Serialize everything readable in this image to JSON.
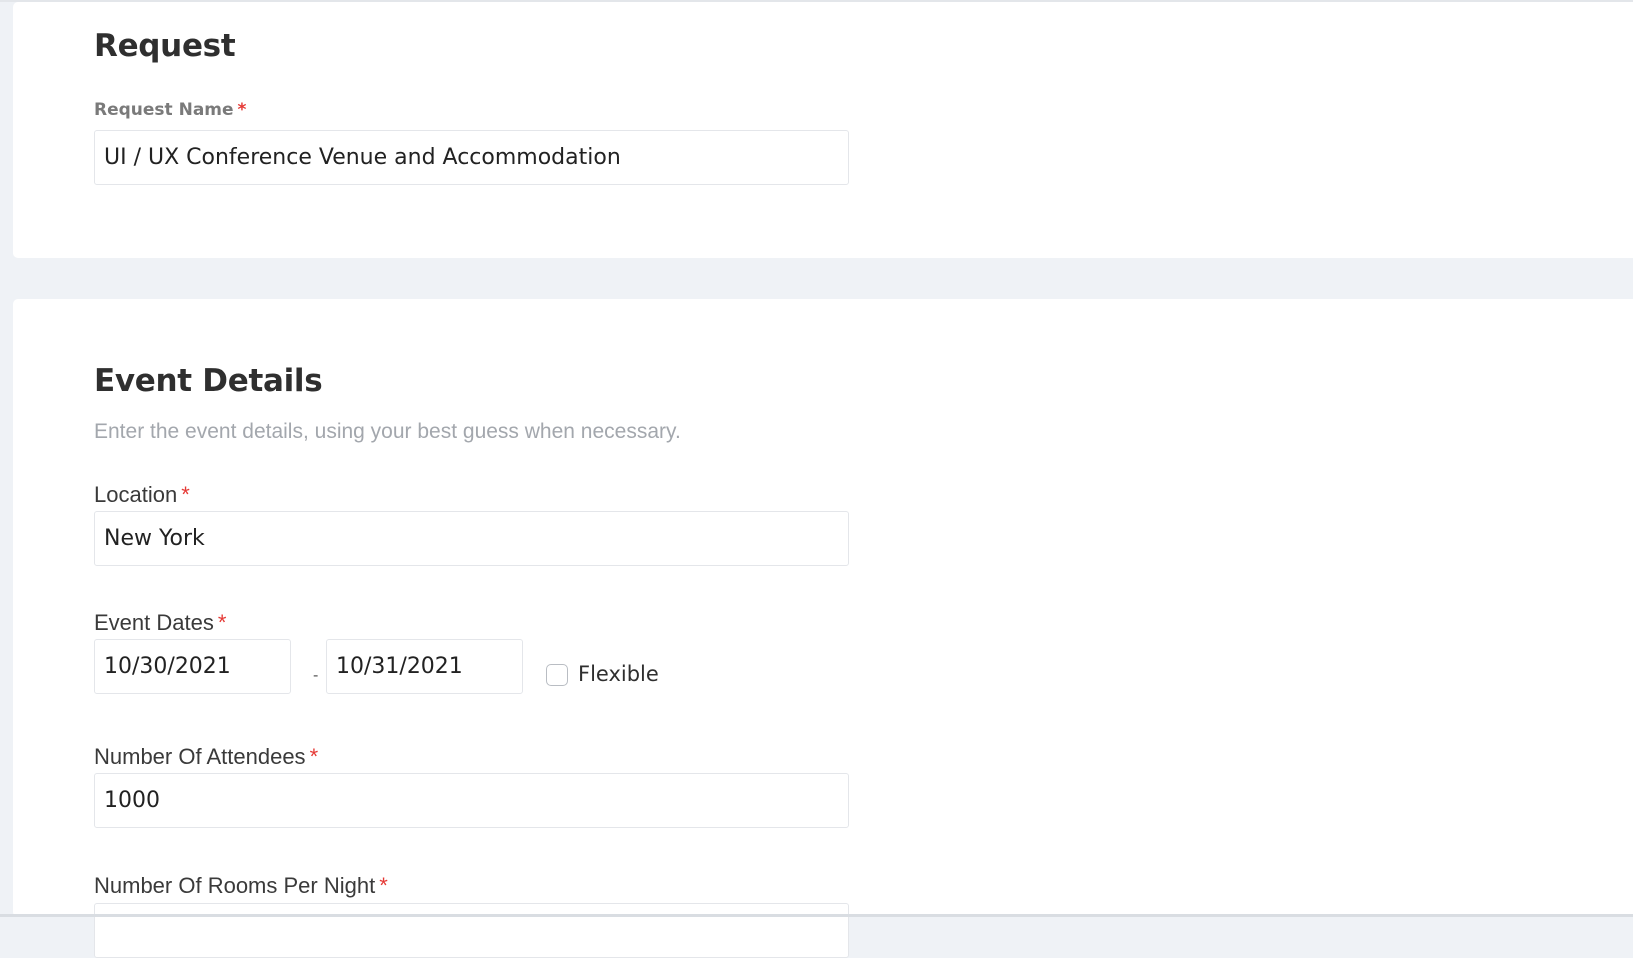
{
  "request": {
    "title": "Request",
    "name_label": "Request Name",
    "name_value": "UI / UX Conference Venue and Accommodation",
    "required_mark": "*"
  },
  "event_details": {
    "title": "Event Details",
    "description": "Enter the event details, using your best guess when necessary.",
    "required_mark": "*",
    "location": {
      "label": "Location",
      "value": "New York"
    },
    "event_dates": {
      "label": "Event Dates",
      "start": "10/30/2021",
      "end": "10/31/2021",
      "separator": "-",
      "flexible_label": "Flexible",
      "flexible_checked": false
    },
    "attendees": {
      "label": "Number Of Attendees",
      "value": "1000"
    },
    "rooms_per_night": {
      "label": "Number Of Rooms Per Night",
      "value": ""
    }
  }
}
